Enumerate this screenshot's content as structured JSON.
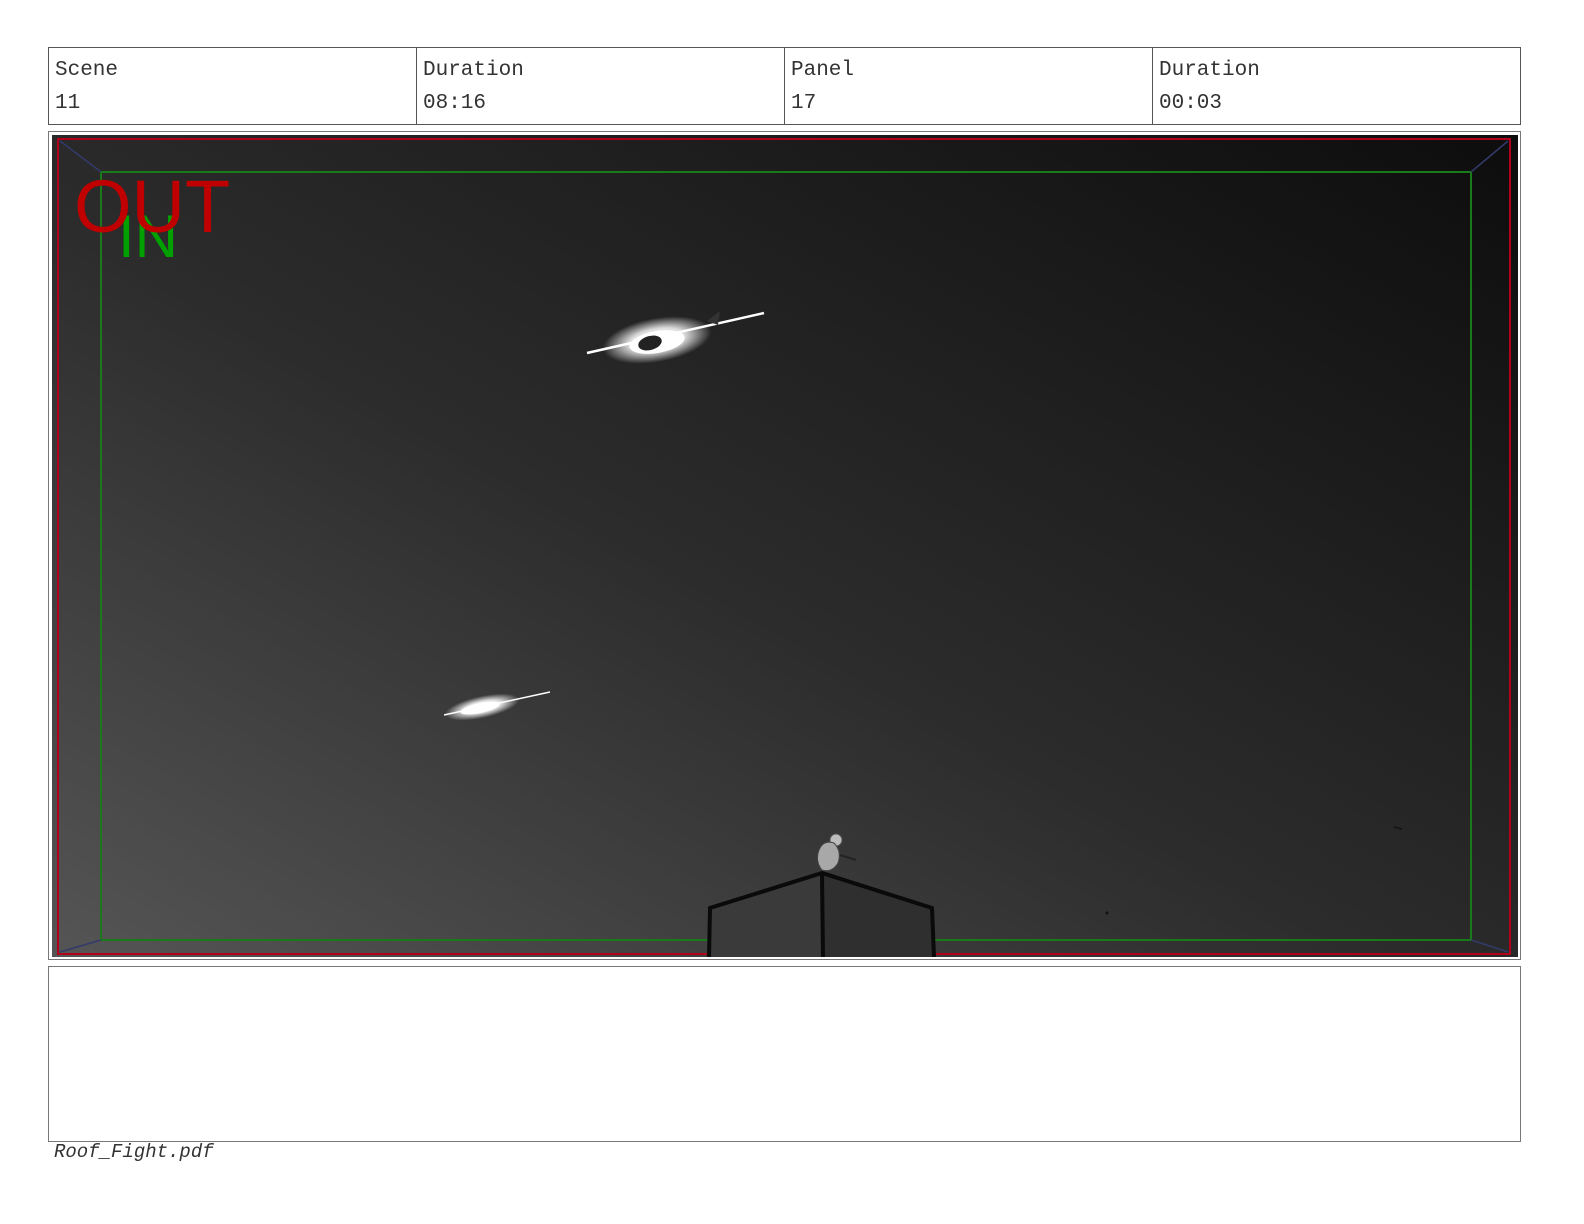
{
  "header": {
    "scene_label": "Scene",
    "scene_value": "11",
    "scene_duration_label": "Duration",
    "scene_duration_value": "08:16",
    "panel_label": "Panel",
    "panel_value": "17",
    "panel_duration_label": "Duration",
    "panel_duration_value": "00:03"
  },
  "frame": {
    "out_label": "OUT",
    "in_label": "IN",
    "out_color": "#c00000",
    "in_color": "#00a000",
    "safe_out_color": "#c0001a",
    "safe_in_color": "#1a7a1a"
  },
  "footer": {
    "filename": "Roof_Fight.pdf"
  }
}
